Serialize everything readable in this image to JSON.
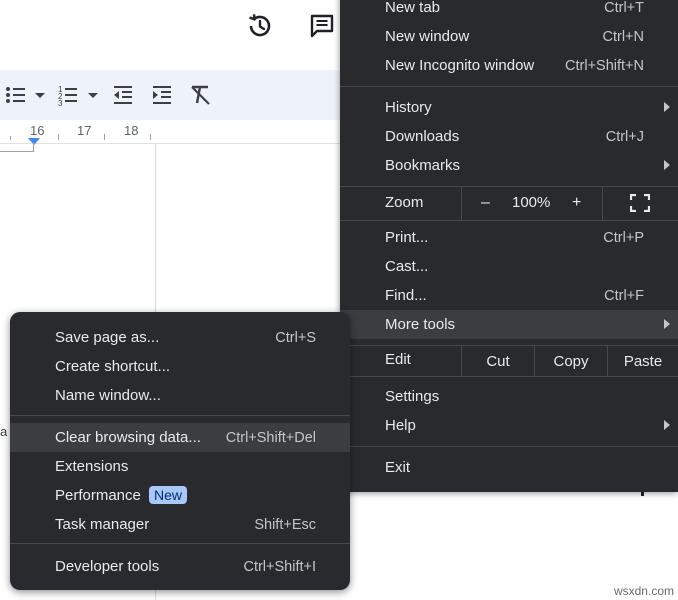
{
  "background": {
    "ruler_numbers": [
      "16",
      "17",
      "18"
    ],
    "stray_text": "a",
    "accent": "#4285f4",
    "toolbar_bg": "#eef3fb"
  },
  "main_menu": {
    "bg": "#292a2d",
    "items": [
      {
        "label": "New tab",
        "shortcut": "Ctrl+T"
      },
      {
        "label": "New window",
        "shortcut": "Ctrl+N"
      },
      {
        "label": "New Incognito window",
        "shortcut": "Ctrl+Shift+N"
      },
      {
        "label": "History",
        "shortcut": ""
      },
      {
        "label": "Downloads",
        "shortcut": "Ctrl+J"
      },
      {
        "label": "Bookmarks",
        "shortcut": ""
      },
      {
        "label": "Print...",
        "shortcut": "Ctrl+P"
      },
      {
        "label": "Cast...",
        "shortcut": ""
      },
      {
        "label": "Find...",
        "shortcut": "Ctrl+F"
      },
      {
        "label": "More tools",
        "shortcut": ""
      },
      {
        "label": "Settings",
        "shortcut": ""
      },
      {
        "label": "Help",
        "shortcut": ""
      },
      {
        "label": "Exit",
        "shortcut": ""
      }
    ],
    "zoom": {
      "label": "Zoom",
      "minus": "–",
      "value": "100%",
      "plus": "+"
    },
    "edit": {
      "label": "Edit",
      "cut": "Cut",
      "copy": "Copy",
      "paste": "Paste"
    }
  },
  "sub_menu": {
    "items": [
      {
        "label": "Save page as...",
        "shortcut": "Ctrl+S"
      },
      {
        "label": "Create shortcut...",
        "shortcut": ""
      },
      {
        "label": "Name window...",
        "shortcut": ""
      },
      {
        "label": "Clear browsing data...",
        "shortcut": "Ctrl+Shift+Del"
      },
      {
        "label": "Extensions",
        "shortcut": ""
      },
      {
        "label": "Performance",
        "shortcut": "",
        "badge": "New"
      },
      {
        "label": "Task manager",
        "shortcut": "Shift+Esc"
      },
      {
        "label": "Developer tools",
        "shortcut": "Ctrl+Shift+I"
      }
    ]
  },
  "watermark": "wsxdn.com"
}
